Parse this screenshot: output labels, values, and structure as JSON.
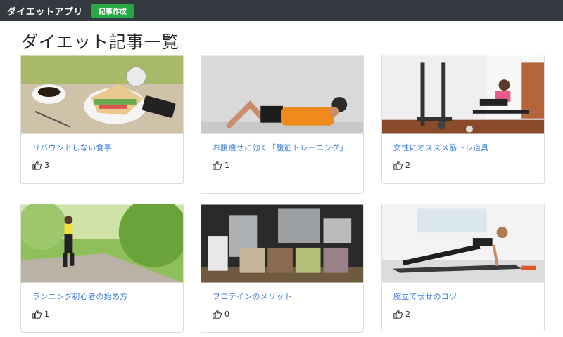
{
  "navbar": {
    "brand": "ダイエットアプリ",
    "create_button": "記事作成"
  },
  "page": {
    "title": "ダイエット記事一覧"
  },
  "cards": [
    {
      "title": "リバウンドしない食事",
      "likes": "3",
      "image": "sandwich-breakfast-photo"
    },
    {
      "title": "お腹痩せに効く「腹筋トレーニング」",
      "likes": "1",
      "image": "situp-exercise-photo"
    },
    {
      "title": "女性にオススメ筋トレ道具",
      "likes": "2",
      "image": "home-gym-equipment-photo"
    },
    {
      "title": "ランニング初心者の始め方",
      "likes": "1",
      "image": "park-running-photo"
    },
    {
      "title": "プロテインのメリット",
      "likes": "0",
      "image": "protein-shakes-photo"
    },
    {
      "title": "腕立て伏せのコツ",
      "likes": "2",
      "image": "pushup-exercise-photo"
    }
  ],
  "icons": {
    "like": "thumbs-up-icon"
  }
}
